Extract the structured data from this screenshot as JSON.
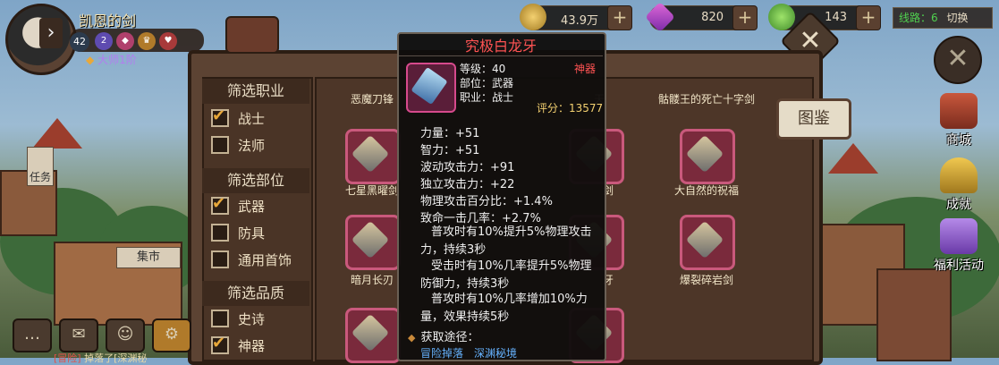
{
  "player": {
    "name": "凯恩的剑",
    "level": "42",
    "badge_level": "2",
    "title": "大师1阶"
  },
  "resources": {
    "gold": "43.9万",
    "diamond": "820",
    "heart": "143",
    "plus": "+"
  },
  "line_switch": {
    "label": "线路：6",
    "action": "切换"
  },
  "sidebar": {
    "quest": "任务",
    "market": "集市",
    "store": "商城",
    "achievement": "成就",
    "welfare": "福利活动",
    "tujian": "图鉴"
  },
  "filters": {
    "class_title": "筛选职业",
    "classes": [
      {
        "label": "战士",
        "checked": true
      },
      {
        "label": "法师",
        "checked": false
      }
    ],
    "slot_title": "筛选部位",
    "slots": [
      {
        "label": "武器",
        "checked": true
      },
      {
        "label": "防具",
        "checked": false
      },
      {
        "label": "通用首饰",
        "checked": false
      }
    ],
    "quality_title": "筛选品质",
    "qualities": [
      {
        "label": "史诗",
        "checked": false
      },
      {
        "label": "神器",
        "checked": true
      }
    ]
  },
  "items": {
    "row1": [
      "恶魔刀锋",
      "天",
      "骷髅王的死亡十字剑"
    ],
    "row2": [
      "七星黑曜剑",
      "剑",
      "大自然的祝福"
    ],
    "row3": [
      "暗月长刃",
      "牙",
      "爆裂碎岩剑"
    ]
  },
  "tooltip": {
    "name": "究极白龙牙",
    "level": "等级：40",
    "slot": "部位：武器",
    "class": "职业：战士",
    "quality": "神器",
    "score": "评分：13577",
    "stats": [
      "力量：+51",
      "智力：+51",
      "波动攻击力：+91",
      "独立攻击力：+22",
      "物理攻击百分比：+1.4%",
      "致命一击几率：+2.7%"
    ],
    "effects": [
      "普攻时有10%提升5%物理攻击力，持续3秒",
      "受击时有10%几率提升5%物理防御力，持续3秒",
      "普攻时有10%几率增加10%力量，效果持续5秒"
    ],
    "source_title": "获取途径：",
    "sources": [
      "冒险掉落",
      "深渊秘境"
    ]
  },
  "bottom_bar": {
    "chat_prefix": "[冒险]",
    "chat_text": "掉落了[深渊秘"
  }
}
